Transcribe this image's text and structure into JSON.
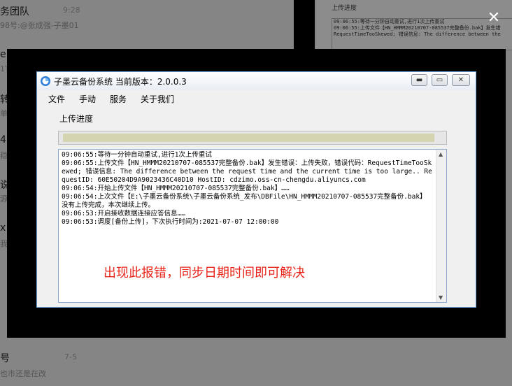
{
  "background": {
    "chat_items": [
      {
        "title": "务团队",
        "sub": "98号:@张成强-子墨01",
        "time": "9:28"
      },
      {
        "title": "e",
        "sub": "1T",
        "time": ""
      },
      {
        "title": "转",
        "sub": "单",
        "time": ""
      },
      {
        "title": "4",
        "sub": "稳",
        "time": ""
      },
      {
        "title": "说",
        "sub": "源",
        "time": ""
      },
      {
        "title": "x",
        "sub": "我",
        "time": ""
      },
      {
        "title": "号",
        "sub": "也市还是在改",
        "time": "7-5"
      }
    ],
    "app_title": "上传进度",
    "app_log": [
      "09:06:55:等待一分钟自动重试,进行1次上传重试",
      "09:06:55:上传文件【HN_HMMM20210707-085537完整备份.bak】发生错",
      "RequestTimeTooSkewed; 错误信息: The difference between the"
    ],
    "close_glyph": "✕"
  },
  "window": {
    "title": "子墨云备份系统  当前版本：2.0.0.3",
    "min_glyph": "▬",
    "max_glyph": "▭",
    "close_glyph": "✕"
  },
  "menu": {
    "items": [
      "文件",
      "手动",
      "服务",
      "关于我们"
    ]
  },
  "upload": {
    "label": "上传进度",
    "progress_fraction": 0.98
  },
  "log": {
    "lines": [
      "09:06:55:等待一分钟自动重试,进行1次上传重试",
      "09:06:55:上传文件【HN_HMMM20210707-085537完整备份.bak】发生错误：上传失败，错误代码：RequestTimeTooSkewed; 错误信息: The difference between the request time and the current time is too large.. RequestID: 60E50204D9A9023436C40D10 HostID: cdzimo.oss-cn-chengdu.aliyuncs.com",
      "09:06:54:开始上传文件【HN_HMMM20210707-085537完整备份.bak】……",
      "09:06:54:上次文件【E:\\子墨云备份系统\\子墨云备份系统_发布\\DBFile\\HN_HMMM20210707-085537完整备份.bak】没有上传完成，本次继续上传。",
      "09:06:53:开启接收数据连接应答信息……",
      "09:06:53:调度[备份上传]，下次执行时间为:2021-07-07 12:00:00"
    ]
  },
  "annotation": {
    "text": "出现此报错，同步日期时间即可解决",
    "color": "#e8251b"
  }
}
